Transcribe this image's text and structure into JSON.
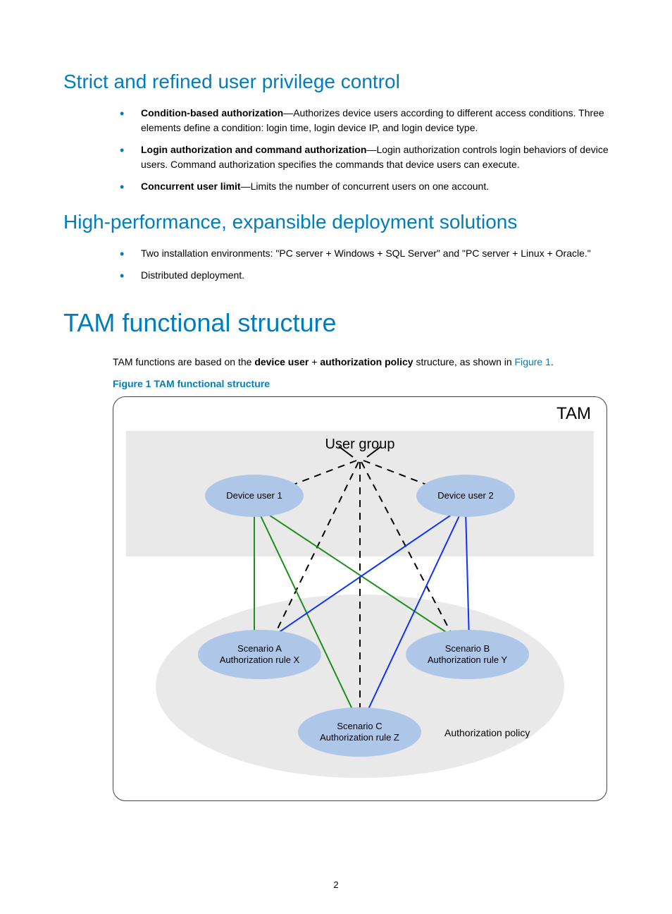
{
  "section1": {
    "heading": "Strict and refined user privilege control",
    "bullets": [
      {
        "term": "Condition-based authorization",
        "text": "—Authorizes device users according to different access conditions. Three elements define a condition: login time, login device IP, and login device type."
      },
      {
        "term": "Login authorization and command authorization",
        "text": "—Login authorization controls login behaviors of device users. Command authorization specifies the commands that device users can execute."
      },
      {
        "term": "Concurrent user limit",
        "text": "—Limits the number of concurrent users on one account."
      }
    ]
  },
  "section2": {
    "heading": "High-performance, expansible deployment solutions",
    "bullets": [
      {
        "text": "Two installation environments: \"PC server + Windows + SQL Server\" and \"PC server + Linux + Oracle.\""
      },
      {
        "text": "Distributed deployment."
      }
    ]
  },
  "section3": {
    "heading": "TAM functional structure",
    "intro_pre": "TAM functions are based on the ",
    "intro_b1": "device user",
    "intro_plus": " + ",
    "intro_b2": "authorization policy",
    "intro_post": " structure, as shown in ",
    "intro_link": "Figure 1",
    "intro_dot": ".",
    "figure_caption": "Figure 1 TAM functional structure"
  },
  "diagram": {
    "tam": "TAM",
    "user_group": "User group",
    "device_user_1": "Device user 1",
    "device_user_2": "Device user 2",
    "scenario_a_l1": "Scenario A",
    "scenario_a_l2": "Authorization rule X",
    "scenario_b_l1": "Scenario B",
    "scenario_b_l2": "Authorization rule Y",
    "scenario_c_l1": "Scenario C",
    "scenario_c_l2": "Authorization rule Z",
    "auth_policy": "Authorization policy"
  },
  "page_number": "2"
}
